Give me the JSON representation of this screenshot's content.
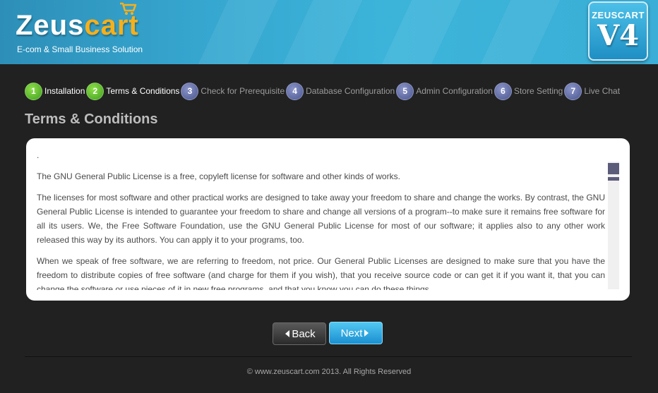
{
  "header": {
    "logo_zeus": "Zeus",
    "logo_cart": "cart",
    "logo_tagline": "E-com & Small Business Solution",
    "badge_top": "ZEUSCART",
    "badge_version": "V4"
  },
  "steps": [
    {
      "num": "1",
      "label": "Installation",
      "state": "done"
    },
    {
      "num": "2",
      "label": "Terms & Conditions",
      "state": "done"
    },
    {
      "num": "3",
      "label": "Check for Prerequisite",
      "state": "todo"
    },
    {
      "num": "4",
      "label": "Database Configuration",
      "state": "todo"
    },
    {
      "num": "5",
      "label": "Admin Configuration",
      "state": "todo"
    },
    {
      "num": "6",
      "label": "Store Setting",
      "state": "todo"
    },
    {
      "num": "7",
      "label": "Live Chat",
      "state": "todo"
    }
  ],
  "page_title": "Terms & Conditions",
  "license": {
    "lead": ".",
    "p1": "The GNU General Public License is a free, copyleft license for software and other kinds of works.",
    "p2": "The licenses for most software and other practical works are designed to take away your freedom to share and change the works. By contrast, the GNU General Public License is intended to guarantee your freedom to share and change all versions of a program--to make sure it remains free software for all its users. We, the Free Software Foundation, use the GNU General Public License for most of our software; it applies also to any other work released this way by its authors. You can apply it to your programs, too.",
    "p3": "When we speak of free software, we are referring to freedom, not price. Our General Public Licenses are designed to make sure that you have the freedom to distribute copies of free software (and charge for them if you wish), that you receive source code or can get it if you want it, that you can change the software or use pieces of it in new free programs, and that you know you can do these things."
  },
  "buttons": {
    "back": "Back",
    "next": "Next"
  },
  "footer": "© www.zeuscart.com 2013. All Rights Reserved",
  "colors": {
    "header_blue": "#36a6cf",
    "step_done": "#4caf20",
    "step_todo": "#5a65a0",
    "background": "#212121"
  }
}
